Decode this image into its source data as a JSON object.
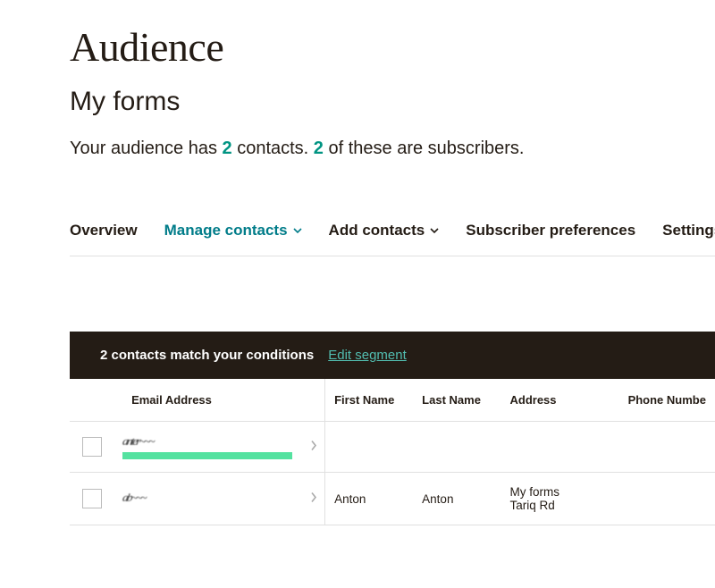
{
  "page_title": "Audience",
  "subtitle": "My forms",
  "stats": {
    "prefix": "Your audience has ",
    "contacts": "2",
    "mid": " contacts. ",
    "subscribers": "2",
    "suffix": " of these are subscribers."
  },
  "tabs": {
    "overview": "Overview",
    "manage": "Manage contacts",
    "add": "Add contacts",
    "prefs": "Subscriber preferences",
    "settings": "Settings"
  },
  "segment": {
    "match": "2 contacts match your conditions",
    "edit": "Edit segment"
  },
  "columns": {
    "email": "Email Address",
    "first": "First Name",
    "last": "Last Name",
    "address": "Address",
    "phone": "Phone Numbe"
  },
  "rows": [
    {
      "email_obscured": "anter~~~",
      "first": "",
      "last": "",
      "address1": "",
      "address2": "",
      "highlighted": true
    },
    {
      "email_obscured": "ab~~~",
      "first": "Anton",
      "last": "Anton",
      "address1": "My forms",
      "address2": "Tariq Rd"
    }
  ]
}
